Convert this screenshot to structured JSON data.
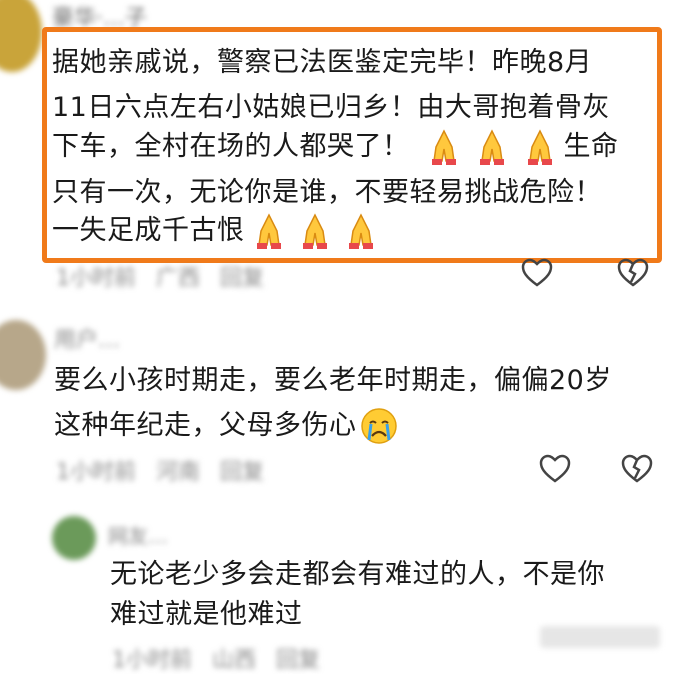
{
  "comment1": {
    "username": "豪华·…子",
    "text_lines": [
      "据她亲戚说，警察已法医鉴定完毕！昨晚8月",
      "11日六点左右小姑娘已归乡！由大哥抱着骨灰",
      "下车，全村在场的人都哭了！",
      "生命",
      "只有一次，无论你是谁，不要轻易挑战危险！",
      "一失足成千古恨"
    ],
    "time": "1小时前",
    "location": "广西",
    "reply_label": "回复",
    "highlight_color": "#f07a1a"
  },
  "comment2": {
    "username": "用户…",
    "text_lines": [
      "要么小孩时期走，要么老年时期走，偏偏20岁",
      "这种年纪走，父母多伤心"
    ],
    "time": "1小时前",
    "location": "河南",
    "reply_label": "回复"
  },
  "reply1": {
    "username": "网友…",
    "text_lines": [
      "无论老少多会走都会有难过的人，不是你",
      "难过就是他难过"
    ],
    "time": "1小时前",
    "location": "山西",
    "reply_label": "回复"
  },
  "icons": {
    "like": "heart-outline-icon",
    "dislike": "broken-heart-icon",
    "pray": "folded-hands-emoji",
    "cry": "crying-face-emoji"
  }
}
